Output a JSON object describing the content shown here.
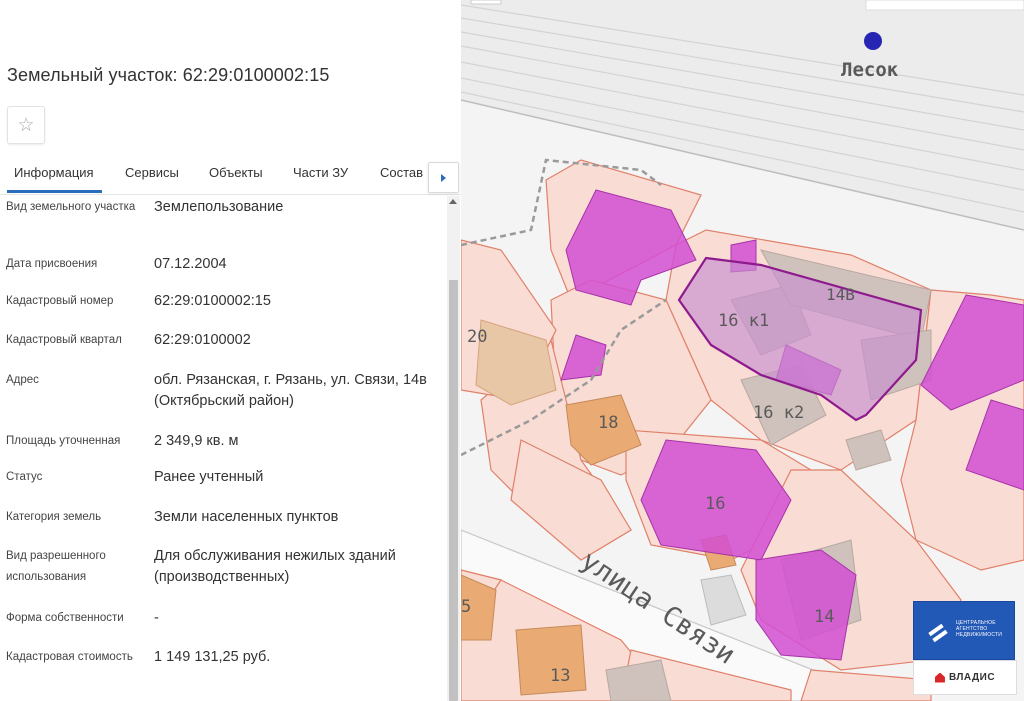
{
  "panel": {
    "title": "Земельный участок: 62:29:0100002:15",
    "tabs": [
      {
        "label": "Информация",
        "active": true
      },
      {
        "label": "Сервисы"
      },
      {
        "label": "Объекты"
      },
      {
        "label": "Части ЗУ"
      },
      {
        "label": "Состав"
      }
    ],
    "rows": [
      {
        "label": "Вид земельного участка",
        "value": "Землепользование"
      },
      {
        "label": "Дата присвоения",
        "value": "07.12.2004"
      },
      {
        "label": "Кадастровый номер",
        "value": "62:29:0100002:15"
      },
      {
        "label": "Кадастровый квартал",
        "value": "62:29:0100002"
      },
      {
        "label": "Адрес",
        "value": "обл. Рязанская, г. Рязань, ул. Связи, 14в (Октябрьский район)"
      },
      {
        "label": "Площадь уточненная",
        "value": "2 349,9 кв. м"
      },
      {
        "label": "Статус",
        "value": "Ранее учтенный"
      },
      {
        "label": "Категория земель",
        "value": "Земли населенных пунктов"
      },
      {
        "label": "Вид разрешенного использования",
        "value": "Для обслуживания нежилых зданий (производственных)"
      },
      {
        "label": "Форма собственности",
        "value": "-"
      },
      {
        "label": "Кадастровая стоимость",
        "value": "1 149 131,25 руб."
      }
    ]
  },
  "map": {
    "station_label": "Лесок",
    "street_label": "улица Связи",
    "labels": [
      "14В",
      "16 к1",
      "16 к2",
      "20",
      "18",
      "16",
      "14",
      "13",
      "5"
    ],
    "logo": {
      "line1": "ЦЕНТРАЛЬНОЕ",
      "line2": "АГЕНТСТВО",
      "line3": "НЕДВИЖИМОСТИ",
      "bottom": "ВЛАДИС"
    }
  },
  "colors": {
    "accent": "#2a6dbd",
    "selected_parcel": "#8e1a8e",
    "building_magenta": "#d24fd2",
    "parcel_fill": "#f9ddd5",
    "parcel_stroke": "#e0806a",
    "brand_blue": "#2258b6"
  }
}
